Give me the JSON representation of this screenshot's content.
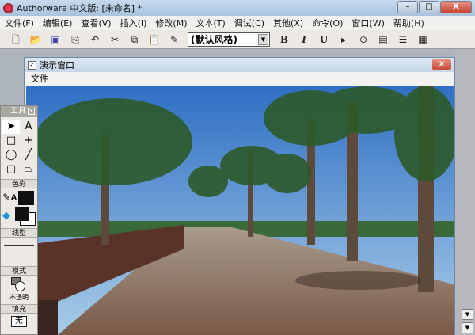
{
  "app": {
    "title": "Authorware 中文版: [未命名] *",
    "min": "–",
    "max": "□",
    "close": "X"
  },
  "menu": [
    "文件(F)",
    "编辑(E)",
    "查看(V)",
    "插入(I)",
    "修改(M)",
    "文本(T)",
    "调试(C)",
    "其他(X)",
    "命令(O)",
    "窗口(W)",
    "帮助(H)"
  ],
  "toolbar": {
    "style_value": "(默认风格)",
    "bold": "B",
    "italic": "I",
    "underline": "U"
  },
  "presentation": {
    "title": "演示窗口",
    "menu_file": "文件",
    "close": "x"
  },
  "tools": {
    "title": "工具",
    "color_label": "色彩",
    "line_label": "线型",
    "mode_label": "模式",
    "mode_value": "不透明",
    "fill_label": "填充",
    "fill_value": "无",
    "text_tool": "A",
    "pen_text": "A"
  }
}
